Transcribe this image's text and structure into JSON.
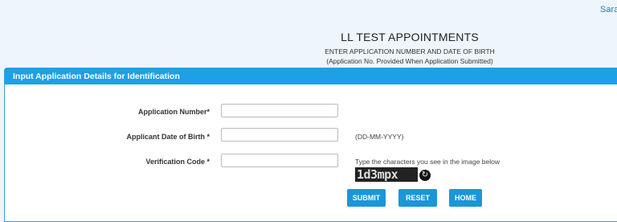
{
  "top_link": "Sara",
  "heading": {
    "title": "LL TEST APPOINTMENTS",
    "subtitle": "ENTER APPLICATION NUMBER AND DATE OF BIRTH",
    "note": "(Application No. Provided When Application Submitted)"
  },
  "panel": {
    "header": "Input Application Details for Identification",
    "application_number_label": "Application Number*",
    "dob_label": "Applicant Date of Birth *",
    "dob_hint": "(DD-MM-YYYY)",
    "verification_label": "Verification Code *",
    "verification_hint": "Type the characters you see in the image below",
    "captcha_text": "1d3mpx",
    "refresh_icon": "refresh-icon",
    "application_number_value": "",
    "dob_value": "",
    "verification_value": ""
  },
  "buttons": {
    "submit": "SUBMIT",
    "reset": "RESET",
    "home": "HOME"
  },
  "colors": {
    "accent": "#1ea0e6",
    "background": "#eef6fb"
  }
}
